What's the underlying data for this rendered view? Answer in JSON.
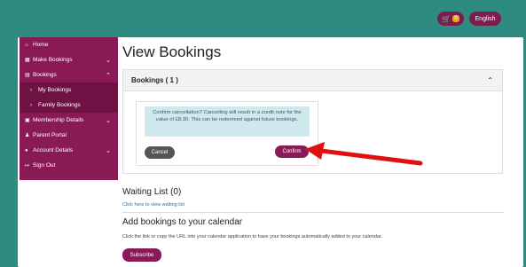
{
  "header": {
    "cart_count": "0",
    "language_label": "English"
  },
  "sidebar": {
    "items": [
      {
        "label": "Home",
        "icon": "home-icon"
      },
      {
        "label": "Make Bookings",
        "icon": "calendar-icon",
        "chevron": "⌄"
      },
      {
        "label": "Bookings",
        "icon": "list-icon",
        "chevron": "⌃"
      },
      {
        "label": "My Bookings",
        "sub": true
      },
      {
        "label": "Family Bookings",
        "sub": true
      },
      {
        "label": "Membership Details",
        "icon": "id-card-icon",
        "chevron": "⌄"
      },
      {
        "label": "Parent Portal",
        "icon": "person-icon"
      },
      {
        "label": "Account Details",
        "icon": "user-icon",
        "chevron": "⌄"
      },
      {
        "label": "Sign Out",
        "icon": "sign-out-icon"
      }
    ]
  },
  "main": {
    "title": "View Bookings",
    "bookings_panel_title": "Bookings ( 1 )",
    "confirm_message": "Confirm cancellation? Cancelling will result in a credit note for the value of £8.30. This can be redeemed against future bookings.",
    "cancel_label": "Cancel",
    "confirm_label": "Confirm",
    "waiting_list_title": "Waiting List (0)",
    "waiting_list_link": "Click here to view waiting list",
    "calendar_title": "Add bookings to your calendar",
    "calendar_desc": "Click the link or copy the URL into your calendar application to have your bookings automatically added to your calendar.",
    "subscribe_label": "Subscribe"
  },
  "colors": {
    "brand": "#8a1a55",
    "header": "#2e8b7f",
    "arrow": "#e01010"
  }
}
